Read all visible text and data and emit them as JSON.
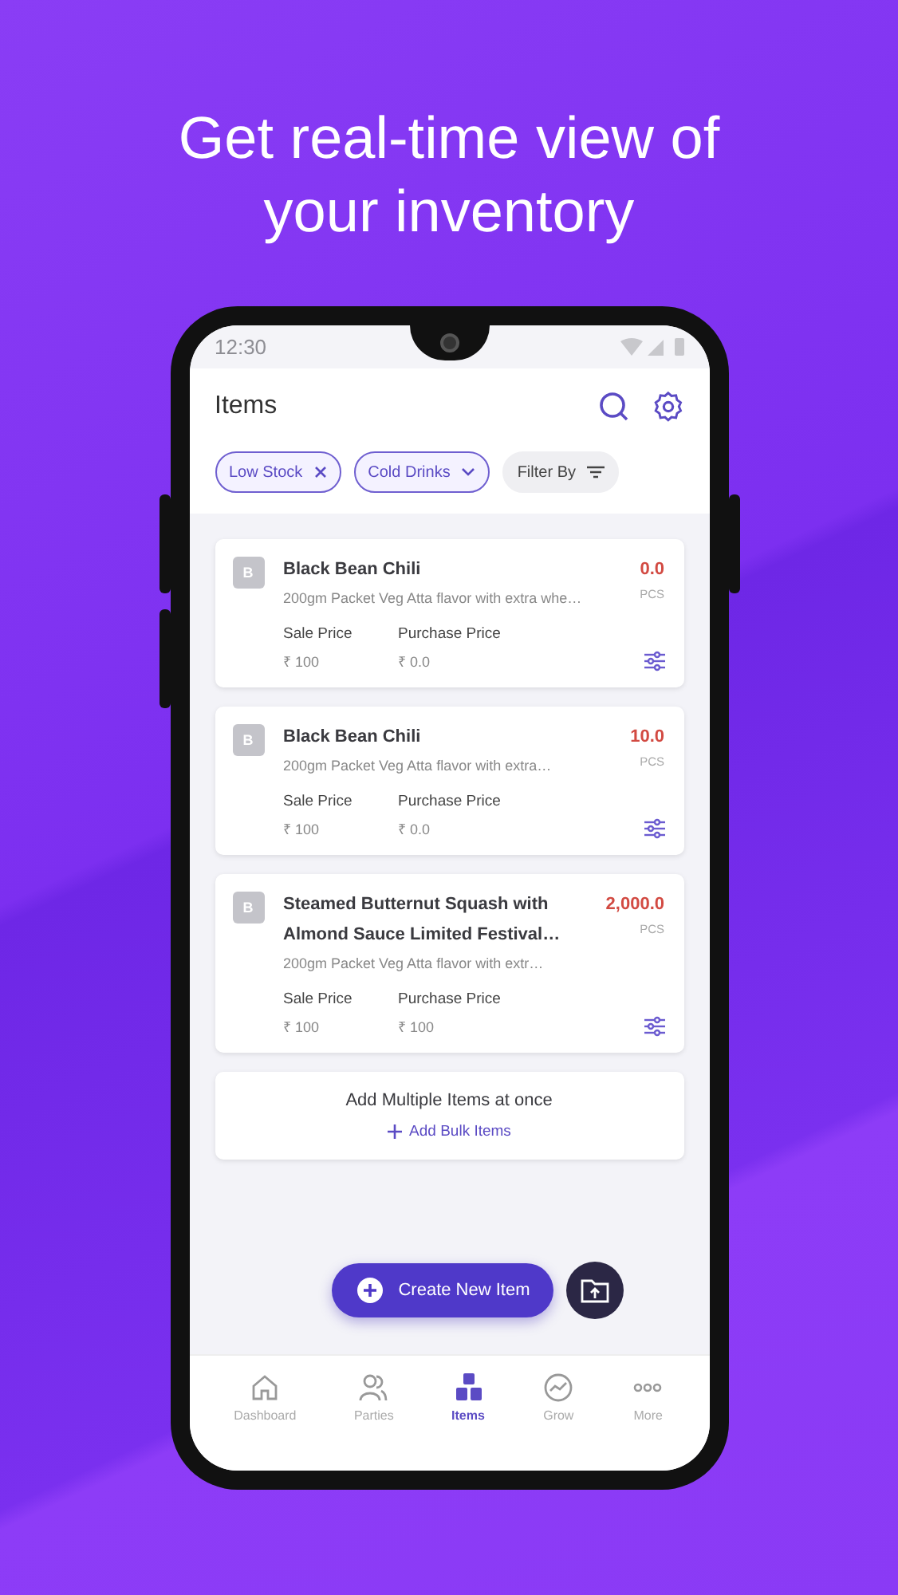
{
  "headline": "Get real-time view of your inventory",
  "status_bar": {
    "time": "12:30"
  },
  "header": {
    "title": "Items"
  },
  "filters": [
    {
      "label": "Low Stock",
      "kind": "removable"
    },
    {
      "label": "Cold Drinks",
      "kind": "dropdown"
    },
    {
      "label": "Filter By",
      "kind": "menu"
    }
  ],
  "items": [
    {
      "avatar": "B",
      "name": "Black Bean Chili",
      "description": "200gm Packet  Veg Atta flavor with extra whe…",
      "quantity": "0.0",
      "unit": "PCS",
      "sale_label": "Sale Price",
      "sale_price": "₹ 100",
      "purchase_label": "Purchase Price",
      "purchase_price": "₹ 0.0"
    },
    {
      "avatar": "B",
      "name": "Black Bean Chili",
      "description": "200gm Packet  Veg Atta flavor with extra…",
      "quantity": "10.0",
      "unit": "PCS",
      "sale_label": "Sale Price",
      "sale_price": "₹ 100",
      "purchase_label": "Purchase Price",
      "purchase_price": "₹ 0.0"
    },
    {
      "avatar": "B",
      "name": "Steamed Butternut Squash with Almond Sauce Limited Festival…",
      "description": "200gm Packet  Veg Atta flavor with extr…",
      "quantity": "2,000.0",
      "unit": "PCS",
      "sale_label": "Sale Price",
      "sale_price": "₹ 100",
      "purchase_label": "Purchase Price",
      "purchase_price": "₹ 100"
    }
  ],
  "bulk": {
    "title": "Add Multiple Items at once",
    "link": "Add Bulk Items"
  },
  "create_button": "Create New Item",
  "nav": [
    {
      "label": "Dashboard",
      "selected": false
    },
    {
      "label": "Parties",
      "selected": false
    },
    {
      "label": "Items",
      "selected": true
    },
    {
      "label": "Grow",
      "selected": false
    },
    {
      "label": "More",
      "selected": false
    }
  ]
}
